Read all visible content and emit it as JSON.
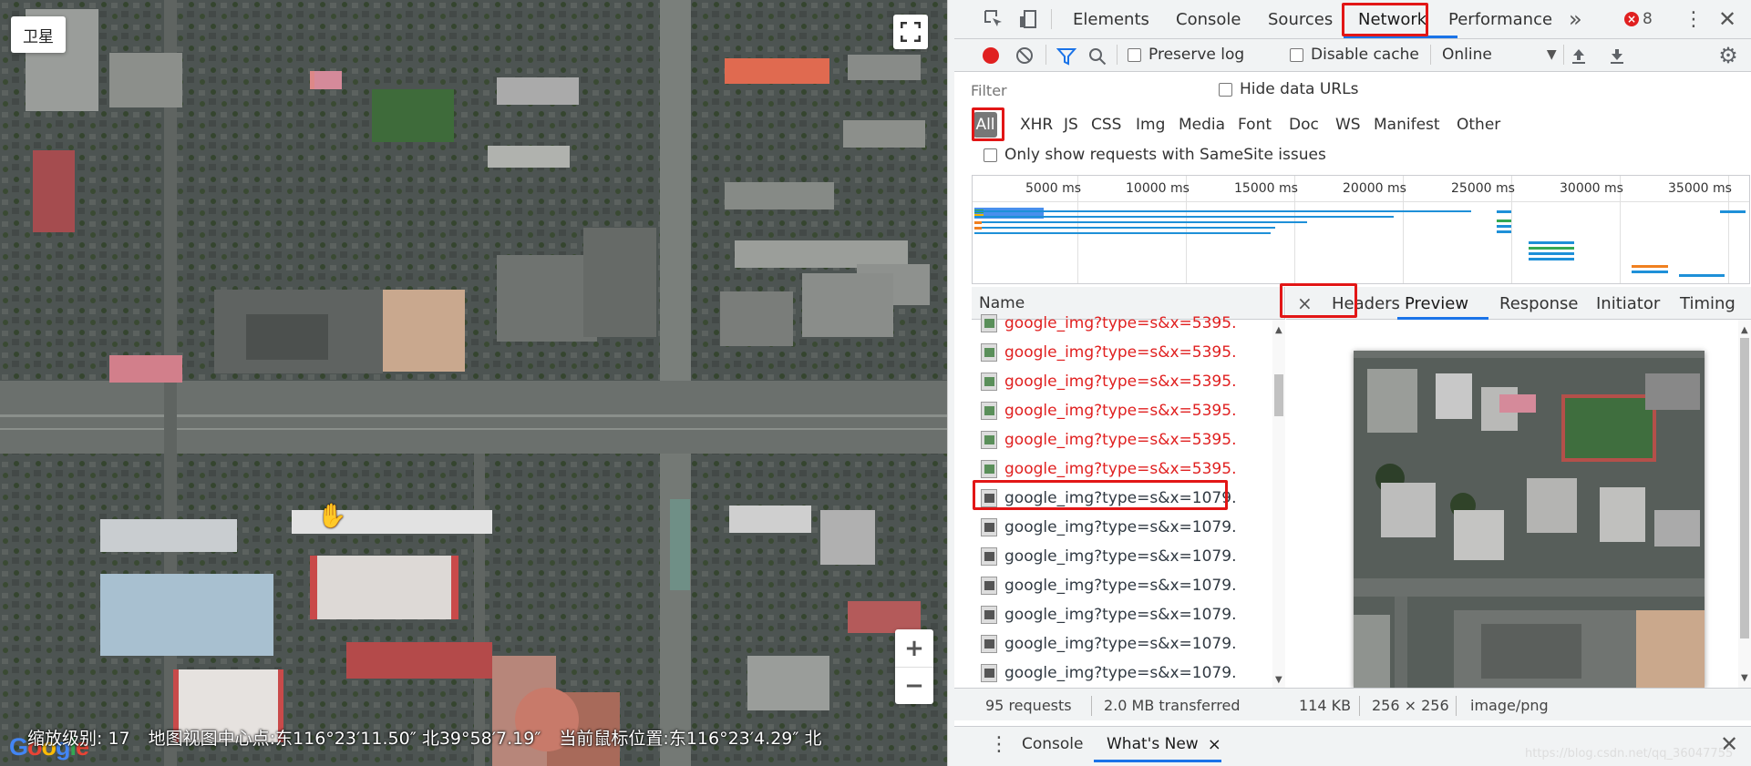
{
  "map": {
    "type_button": "卫星",
    "fullscreen_icon": "fullscreen-icon",
    "zoom_in": "+",
    "zoom_out": "−",
    "status": {
      "zoom_label": "缩放级别:",
      "zoom_value": "17",
      "center_label": "地图视图中心点:",
      "center_lng": "东116°23′11.50″",
      "center_lat": "北39°58′7.19″",
      "mouse_label": "当前鼠标位置:",
      "mouse_lng": "东116°23′4.29″",
      "mouse_lat": "北"
    },
    "logo": {
      "l1": "G",
      "l2": "o",
      "l3": "o",
      "l4": "g",
      "l5": "l",
      "l6": "e"
    }
  },
  "devtools": {
    "tabs": [
      "Elements",
      "Console",
      "Sources",
      "Network",
      "Performance"
    ],
    "more_tabs": "»",
    "error_count": "8",
    "toolbar": {
      "preserve_log": "Preserve log",
      "disable_cache": "Disable cache",
      "throttle": "Online"
    },
    "filter_placeholder": "Filter",
    "hide_data_urls": "Hide data URLs",
    "types": [
      "All",
      "XHR",
      "JS",
      "CSS",
      "Img",
      "Media",
      "Font",
      "Doc",
      "WS",
      "Manifest",
      "Other"
    ],
    "samesite": "Only show requests with SameSite issues",
    "timeline_ticks": [
      "5000 ms",
      "10000 ms",
      "15000 ms",
      "20000 ms",
      "25000 ms",
      "30000 ms",
      "35000 ms"
    ],
    "name_header": "Name",
    "requests": [
      {
        "name": "google_img?type=s&x=5395.",
        "error": true
      },
      {
        "name": "google_img?type=s&x=5395.",
        "error": true
      },
      {
        "name": "google_img?type=s&x=5395.",
        "error": true
      },
      {
        "name": "google_img?type=s&x=5395.",
        "error": true
      },
      {
        "name": "google_img?type=s&x=5395.",
        "error": true
      },
      {
        "name": "google_img?type=s&x=5395.",
        "error": true
      },
      {
        "name": "google_img?type=s&x=1079.",
        "error": false
      },
      {
        "name": "google_img?type=s&x=1079.",
        "error": false
      },
      {
        "name": "google_img?type=s&x=1079.",
        "error": false
      },
      {
        "name": "google_img?type=s&x=1079.",
        "error": false
      },
      {
        "name": "google_img?type=s&x=1079.",
        "error": false
      },
      {
        "name": "google_img?type=s&x=1079.",
        "error": false
      },
      {
        "name": "google_img?type=s&x=1079.",
        "error": false
      }
    ],
    "detail_tabs": [
      "Headers",
      "Preview",
      "Response",
      "Initiator",
      "Timing"
    ],
    "close_icon": "×",
    "summary": {
      "requests": "95 requests",
      "transferred": "2.0 MB transferred",
      "size": "114 KB",
      "dims": "256 × 256",
      "mime": "image/png"
    },
    "drawer": {
      "console": "Console",
      "whats_new": "What's New",
      "close": "×"
    },
    "watermark": "https://blog.csdn.net/qq_36047755"
  },
  "colors": {
    "highlight": "#e21616",
    "record": "#e02020",
    "filter_icon": "#1a73e8",
    "error_text": "#e02020"
  }
}
